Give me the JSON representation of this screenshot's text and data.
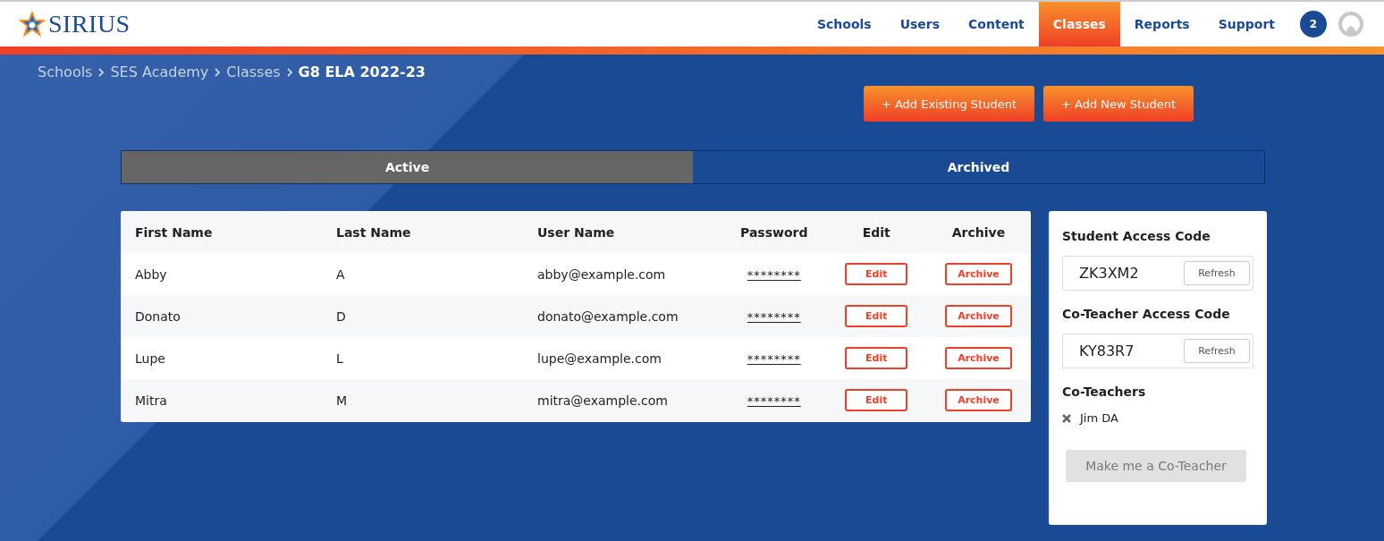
{
  "brand": {
    "name": "SIRIUS"
  },
  "nav": [
    {
      "label": "Schools",
      "selected": false
    },
    {
      "label": "Users",
      "selected": false
    },
    {
      "label": "Content",
      "selected": false
    },
    {
      "label": "Classes",
      "selected": true
    },
    {
      "label": "Reports",
      "selected": false
    },
    {
      "label": "Support",
      "selected": false
    }
  ],
  "notifications": {
    "count": "2"
  },
  "breadcrumb": [
    {
      "label": "Schools",
      "current": false
    },
    {
      "label": "SES Academy",
      "current": false
    },
    {
      "label": "Classes",
      "current": false
    },
    {
      "label": "G8 ELA 2022-23",
      "current": true
    }
  ],
  "actions": [
    "+ Add Existing Student",
    "+ Add New Student"
  ],
  "tabs": [
    {
      "label": "Active",
      "selected": true
    },
    {
      "label": "Archived",
      "selected": false
    }
  ],
  "table": {
    "columns": [
      "First Name",
      "Last Name",
      "User Name",
      "Password",
      "Edit",
      "Archive"
    ],
    "rows": [
      {
        "first": "Abby",
        "last": "A",
        "user": "abby@example.com",
        "password": "********",
        "edit": "Edit",
        "archive": "Archive"
      },
      {
        "first": "Donato",
        "last": "D",
        "user": "donato@example.com",
        "password": "********",
        "edit": "Edit",
        "archive": "Archive"
      },
      {
        "first": "Lupe",
        "last": "L",
        "user": "lupe@example.com",
        "password": "********",
        "edit": "Edit",
        "archive": "Archive"
      },
      {
        "first": "Mitra",
        "last": "M",
        "user": "mitra@example.com",
        "password": "********",
        "edit": "Edit",
        "archive": "Archive"
      }
    ]
  },
  "side": {
    "codes": [
      {
        "title": "Student Access Code",
        "code": "ZK3XM2",
        "button": "Refresh"
      },
      {
        "title": "Co-Teacher Access Code",
        "code": "KY83R7",
        "button": "Refresh"
      }
    ],
    "co_teachers_title": "Co-Teachers",
    "co_teachers": [
      "Jim DA"
    ],
    "make_button": {
      "label": "Make me a Co-Teacher",
      "disabled": true
    }
  }
}
